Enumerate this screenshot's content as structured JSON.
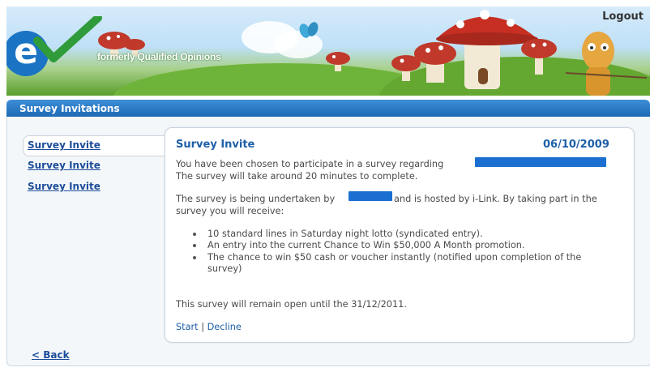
{
  "header": {
    "tagline": "formerly Qualified Opinions",
    "logout_label": "Logout",
    "logo_letter": "e"
  },
  "section": {
    "title": "Survey Invitations"
  },
  "sidebar": {
    "items": [
      {
        "label": "Survey Invite"
      },
      {
        "label": "Survey Invite"
      },
      {
        "label": "Survey Invite"
      }
    ]
  },
  "invite": {
    "title": "Survey Invite",
    "date": "06/10/2009",
    "line1": "You have been chosen to participate in a survey regarding",
    "line2": "The survey will take around 20 minutes to complete.",
    "line3a": "The survey is being undertaken by",
    "line3b": "and is hosted by i-Link. By taking part in the",
    "line4": "survey you will receive:",
    "benefits": [
      "10 standard lines in Saturday night lotto (syndicated entry).",
      "An entry into the current Chance to Win $50,000 A Month promotion.",
      "The chance to win $50 cash or voucher instantly (notified upon completion of the",
      "survey)"
    ],
    "open_until": "This survey will remain open until the 31/12/2011.",
    "start_label": "Start",
    "separator": "|",
    "decline_label": "Decline"
  },
  "footer": {
    "back_label": "< Back"
  },
  "colors": {
    "accent": "#1d5fa8",
    "redaction": "#1b6fd1",
    "section_bar": "#2a78c4"
  }
}
